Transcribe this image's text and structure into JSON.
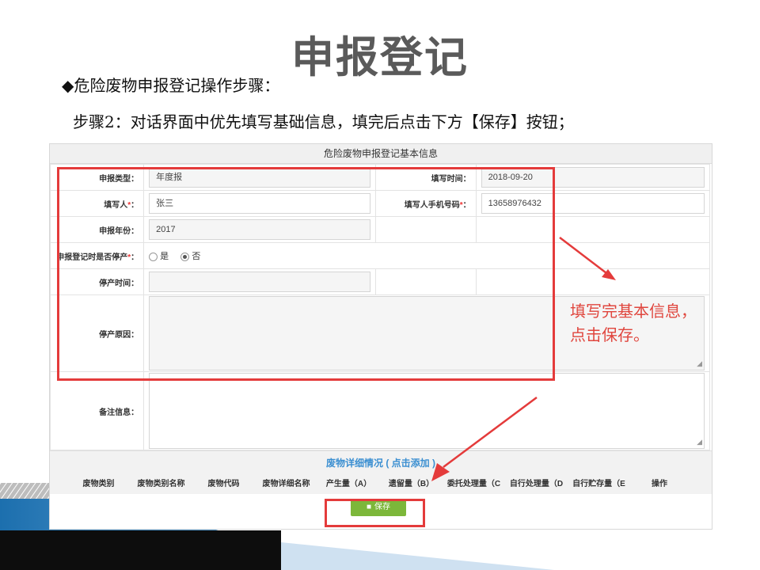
{
  "slide": {
    "title": "申报登记",
    "bullet": "◆危险废物申报登记操作步骤：",
    "step": "步骤2：对话界面中优先填写基础信息，填完后点击下方【保存】按钮；"
  },
  "panel": {
    "title": "危险废物申报登记基本信息"
  },
  "form": {
    "report_type_label": "申报类型：",
    "report_type_value": "年度报",
    "fill_time_label": "填写时间：",
    "fill_time_value": "2018-09-20",
    "filler_label": "填写人",
    "filler_req": "*",
    "filler_colon": "：",
    "filler_value": "张三",
    "phone_label": "填写人手机号码",
    "phone_req": "*",
    "phone_colon": "：",
    "phone_value": "13658976432",
    "year_label": "申报年份：",
    "year_value": "2017",
    "stopped_label": "申报登记时是否停产",
    "stopped_req": "*",
    "stopped_colon": "：",
    "stopped_opt_yes": "是",
    "stopped_opt_no": "否",
    "stopped_selected": "否",
    "stop_time_label": "停产时间：",
    "stop_reason_label": "停产原因：",
    "remarks_label": "备注信息："
  },
  "detail": {
    "title": "废物详细情况 ( 点击添加 )",
    "columns": [
      "废物类别",
      "废物类别名称",
      "废物代码",
      "废物详细名称",
      "产生量（A）",
      "遗留量（B）",
      "委托处理量（C",
      "自行处理量（D",
      "自行贮存量（E",
      "操作"
    ]
  },
  "buttons": {
    "save_label": "保存"
  },
  "annotation": {
    "note": "填写完基本信息，点击保存。"
  },
  "colors": {
    "annotation_red": "#e43b3b",
    "save_green": "#7cb73a",
    "link_blue": "#3b8fd1"
  }
}
